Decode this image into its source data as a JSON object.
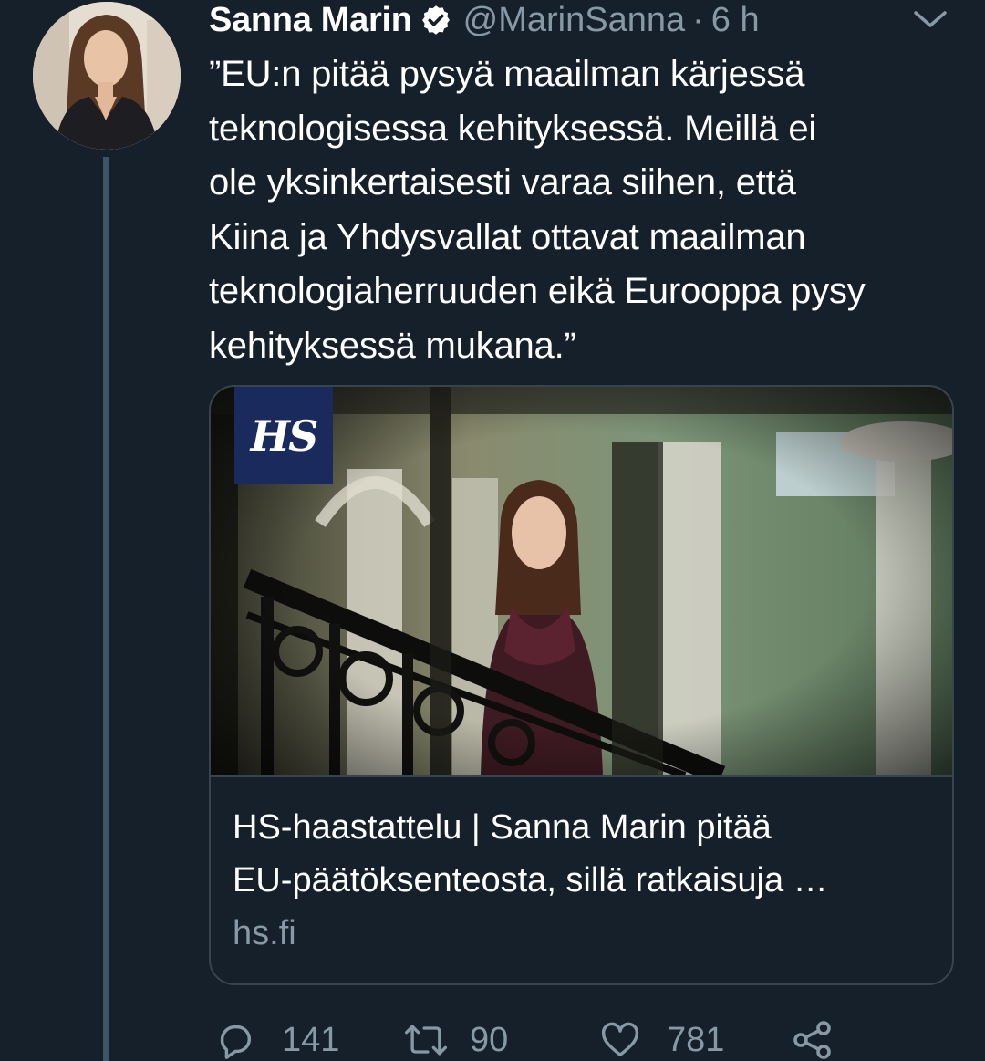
{
  "tweet": {
    "author_name": "Sanna Marin",
    "handle": "@MarinSanna",
    "separator": "·",
    "time": "6 h",
    "text": "”EU:n pitää pysyä maailman kärjessä\nteknologisessa kehityksessä. Meillä ei\nole yksinkertaisesti varaa siihen, että\nKiina ja Yhdysvallat ottavat maailman\nteknologiaherruuden eikä Eurooppa pysy\nkehityksessä mukana.”"
  },
  "card": {
    "logo_text": "HS",
    "title": "HS-haastattelu | Sanna Marin pitää\nEU-päätöksenteosta, sillä ratkaisuja …",
    "domain": "hs.fi"
  },
  "actions": {
    "reply_count": "141",
    "retweet_count": "90",
    "like_count": "781"
  },
  "icons": {
    "verified": "verified-badge-icon",
    "chevron": "chevron-down-icon",
    "reply": "reply-icon",
    "retweet": "retweet-icon",
    "like": "heart-icon",
    "share": "share-icon"
  },
  "colors": {
    "background": "#15202b",
    "secondary_text": "#8899a6",
    "border": "#38444d",
    "hs_logo_bg": "#1b2a5c"
  }
}
